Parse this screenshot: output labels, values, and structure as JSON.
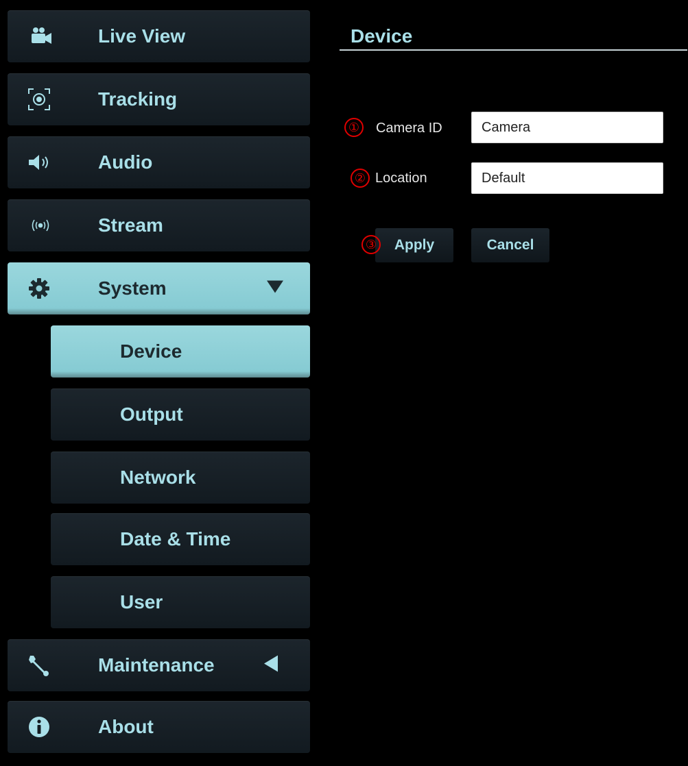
{
  "sidebar": {
    "items": [
      {
        "label": "Live View",
        "icon": "video-camera-icon"
      },
      {
        "label": "Tracking",
        "icon": "tracking-target-icon"
      },
      {
        "label": "Audio",
        "icon": "speaker-icon"
      },
      {
        "label": "Stream",
        "icon": "broadcast-icon"
      },
      {
        "label": "System",
        "icon": "gear-icon",
        "expanded": true
      },
      {
        "label": "Maintenance",
        "icon": "wrench-icon",
        "expanded": false
      },
      {
        "label": "About",
        "icon": "info-icon"
      }
    ],
    "system_sub": [
      {
        "label": "Device",
        "selected": true
      },
      {
        "label": "Output"
      },
      {
        "label": "Network"
      },
      {
        "label": "Date & Time"
      },
      {
        "label": "User"
      }
    ]
  },
  "content": {
    "title": "Device",
    "fields": [
      {
        "marker": "①",
        "label": "Camera ID",
        "value": "Camera"
      },
      {
        "marker": "②",
        "label": "Location",
        "value": "Default"
      }
    ],
    "apply_marker": "③",
    "apply_label": "Apply",
    "cancel_label": "Cancel"
  },
  "colors": {
    "accent": "#a9dfe8",
    "active_bg": "#8ed0d8",
    "marker": "#e00000",
    "background": "#000000"
  }
}
